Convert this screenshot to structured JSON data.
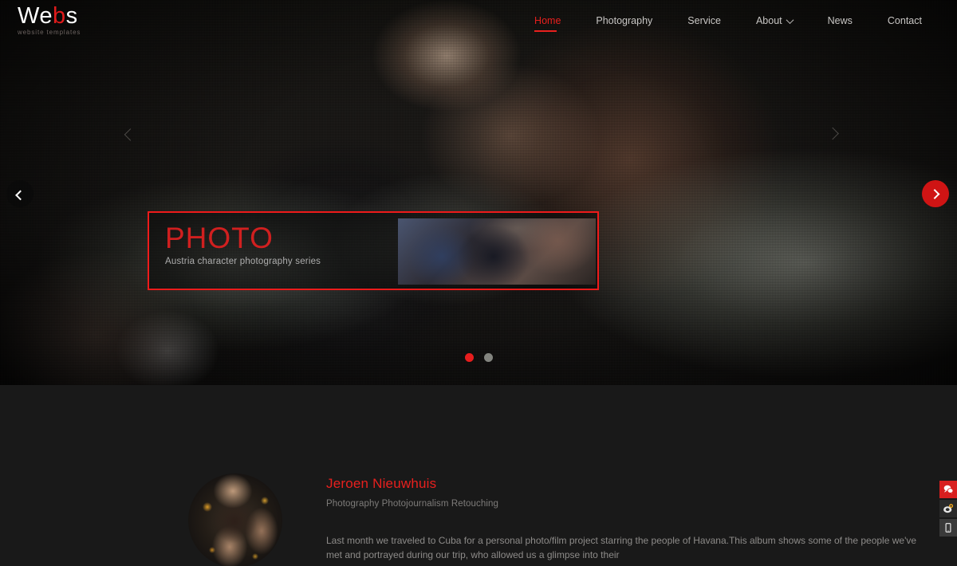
{
  "site": {
    "logo_main": "Webs",
    "logo_accent_letter": "b",
    "logo_sub": "website templates",
    "accent_color": "#e8201e",
    "background_color": "#191919"
  },
  "nav": {
    "items": [
      {
        "label": "Home",
        "active": true,
        "has_dropdown": false
      },
      {
        "label": "Photography",
        "active": false,
        "has_dropdown": false
      },
      {
        "label": "Service",
        "active": false,
        "has_dropdown": false
      },
      {
        "label": "About",
        "active": false,
        "has_dropdown": true
      },
      {
        "label": "News",
        "active": false,
        "has_dropdown": false
      },
      {
        "label": "Contact",
        "active": false,
        "has_dropdown": false
      }
    ]
  },
  "hero": {
    "caption_title": "PHOTO",
    "caption_subtitle": "Austria character photography series",
    "prev_icon": "chevron-left-icon",
    "next_icon": "chevron-right-icon",
    "slides": [
      {
        "index": 1,
        "active": true
      },
      {
        "index": 2,
        "active": false
      }
    ]
  },
  "testimonial": {
    "name": "Jeroen Nieuwhuis",
    "role": "Photography Photojournalism Retouching",
    "text": "Last month we traveled to Cuba for a personal photo/film project starring the people of Havana.This album shows some of the people we've met and portrayed during our trip, who allowed us a glimpse into their",
    "prev_icon": "chevron-left-icon",
    "next_icon": "chevron-right-icon",
    "avatar_alt": "avatar"
  },
  "side_toolbar": {
    "items": [
      {
        "name": "qq-icon",
        "label": "QQ",
        "color": "#d81f1f"
      },
      {
        "name": "weibo-icon",
        "label": "Weibo",
        "color": "#2a2a2a"
      },
      {
        "name": "mobile-icon",
        "label": "Mobile",
        "color": "#3a3a3a"
      }
    ]
  }
}
